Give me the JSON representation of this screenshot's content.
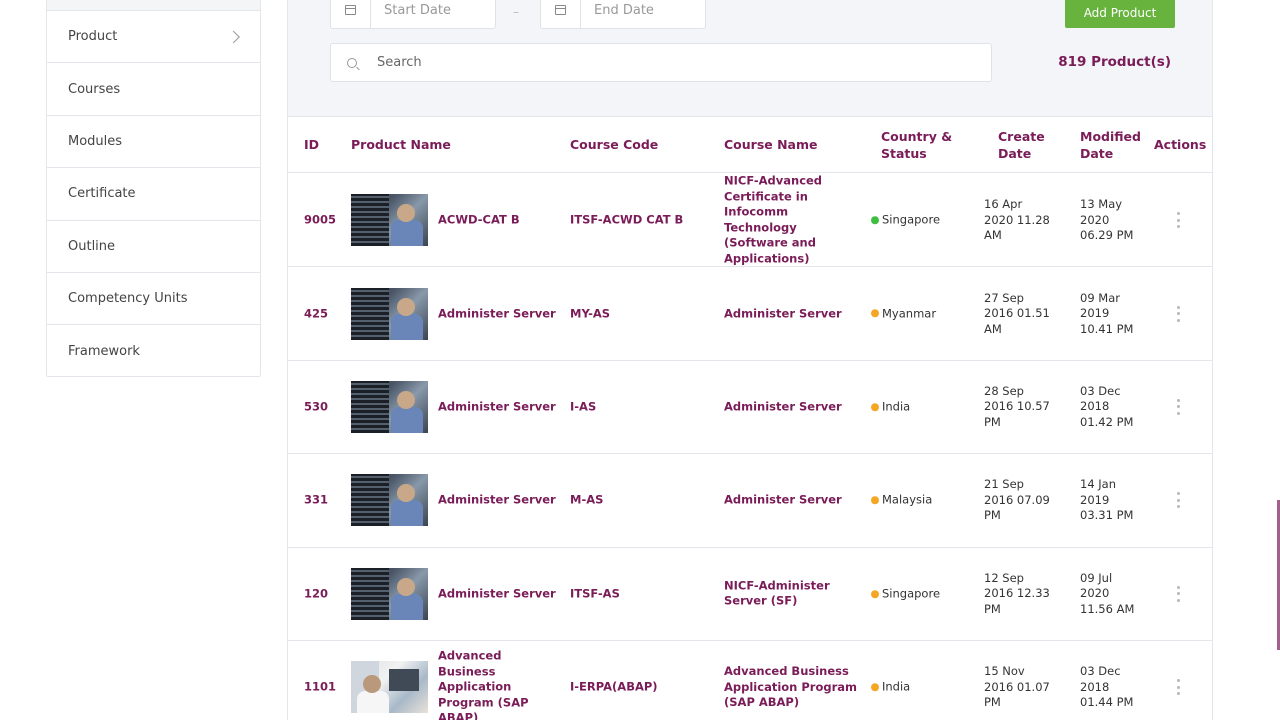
{
  "sidebar": {
    "items": [
      {
        "label": "Product",
        "has_chevron": true
      },
      {
        "label": "Courses"
      },
      {
        "label": "Modules"
      },
      {
        "label": "Certificate"
      },
      {
        "label": "Outline"
      },
      {
        "label": "Competency Units"
      },
      {
        "label": "Framework"
      }
    ]
  },
  "filters": {
    "start_date_placeholder": "Start Date",
    "end_date_placeholder": "End Date",
    "separator": "–",
    "add_button_label": "Add Product",
    "search_placeholder": "Search",
    "product_count": "819 Product(s)"
  },
  "table": {
    "headers": {
      "id": "ID",
      "product_name": "Product Name",
      "course_code": "Course Code",
      "course_name": "Course Name",
      "country_status_1": "Country &",
      "country_status_2": "Status",
      "create_1": "Create",
      "create_2": "Date",
      "modified_1": "Modified",
      "modified_2": "Date",
      "actions": "Actions"
    },
    "rows": [
      {
        "id": "9005",
        "product_name": "ACWD-CAT B",
        "course_code": "ITSF-ACWD CAT B",
        "course_name": "NICF-Advanced Certificate in Infocomm Technology (Software and Applications)",
        "country": "Singapore",
        "status_color": "#3fbf3f",
        "create_1": "16 Apr",
        "create_2": "2020 11.28",
        "create_3": "AM",
        "mod_1": "13 May",
        "mod_2": "2020",
        "mod_3": "06.29 PM",
        "thumb": "server"
      },
      {
        "id": "425",
        "product_name": "Administer Server",
        "course_code": "MY-AS",
        "course_name": "Administer Server",
        "country": "Myanmar",
        "status_color": "#f5a623",
        "create_1": "27 Sep",
        "create_2": "2016 01.51",
        "create_3": "AM",
        "mod_1": "09 Mar",
        "mod_2": "2019",
        "mod_3": "10.41 PM",
        "thumb": "server"
      },
      {
        "id": "530",
        "product_name": "Administer Server",
        "course_code": "I-AS",
        "course_name": "Administer Server",
        "country": "India",
        "status_color": "#f5a623",
        "create_1": "28 Sep",
        "create_2": "2016 10.57",
        "create_3": "PM",
        "mod_1": "03 Dec",
        "mod_2": "2018",
        "mod_3": "01.42 PM",
        "thumb": "server"
      },
      {
        "id": "331",
        "product_name": "Administer Server",
        "course_code": "M-AS",
        "course_name": "Administer Server",
        "country": "Malaysia",
        "status_color": "#f5a623",
        "create_1": "21 Sep",
        "create_2": "2016 07.09",
        "create_3": "PM",
        "mod_1": "14 Jan",
        "mod_2": "2019",
        "mod_3": "03.31 PM",
        "thumb": "server"
      },
      {
        "id": "120",
        "product_name": "Administer Server",
        "course_code": "ITSF-AS",
        "course_name": "NICF-Administer Server (SF)",
        "country": "Singapore",
        "status_color": "#f5a623",
        "create_1": "12 Sep",
        "create_2": "2016 12.33",
        "create_3": "PM",
        "mod_1": "09 Jul",
        "mod_2": "2020",
        "mod_3": "11.56 AM",
        "thumb": "server"
      },
      {
        "id": "1101",
        "product_name": "Advanced Business Application Program (SAP ABAP)",
        "course_code": "I-ERPA(ABAP)",
        "course_name": "Advanced Business Application Program (SAP ABAP)",
        "country": "India",
        "status_color": "#f5a623",
        "create_1": "15 Nov",
        "create_2": "2016 01.07",
        "create_3": "PM",
        "mod_1": "03 Dec",
        "mod_2": "2018",
        "mod_3": "01.44 PM",
        "thumb": "office"
      }
    ]
  }
}
